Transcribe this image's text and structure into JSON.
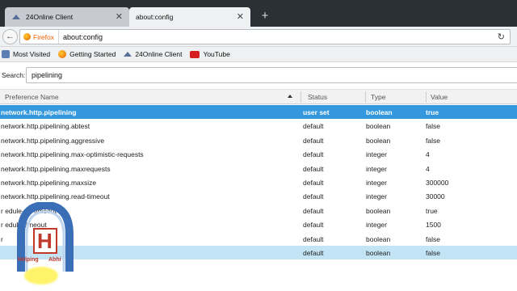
{
  "tabs": [
    {
      "title": "24Online Client",
      "close": "✕"
    },
    {
      "title": "about:config",
      "close": "✕"
    }
  ],
  "new_tab": "+",
  "nav": {
    "back": "←",
    "identity": "Firefox",
    "url": "about:config",
    "reload": "↻"
  },
  "bookmarks": [
    {
      "label": "Most Visited"
    },
    {
      "label": "Getting Started"
    },
    {
      "label": "24Online Client"
    },
    {
      "label": "YouTube"
    }
  ],
  "search": {
    "label": "Search:",
    "value": "pipelining"
  },
  "columns": [
    "Preference Name",
    "Status",
    "Type",
    "Value"
  ],
  "rows": [
    {
      "name": "network.http.pipelining",
      "status": "user set",
      "type": "boolean",
      "value": "true"
    },
    {
      "name": "network.http.pipelining.abtest",
      "status": "default",
      "type": "boolean",
      "value": "false"
    },
    {
      "name": "network.http.pipelining.aggressive",
      "status": "default",
      "type": "boolean",
      "value": "false"
    },
    {
      "name": "network.http.pipelining.max-optimistic-requests",
      "status": "default",
      "type": "integer",
      "value": "4"
    },
    {
      "name": "network.http.pipelining.maxrequests",
      "status": "default",
      "type": "integer",
      "value": "4"
    },
    {
      "name": "network.http.pipelining.maxsize",
      "status": "default",
      "type": "integer",
      "value": "300000"
    },
    {
      "name": "network.http.pipelining.read-timeout",
      "status": "default",
      "type": "integer",
      "value": "30000"
    },
    {
      "name": "r                  edule-on-timeout",
      "status": "default",
      "type": "boolean",
      "value": "true"
    },
    {
      "name": "r                  edule-timeout",
      "status": "default",
      "type": "integer",
      "value": "1500"
    },
    {
      "name": "r",
      "status": "default",
      "type": "boolean",
      "value": "false"
    },
    {
      "name": "",
      "status": "default",
      "type": "boolean",
      "value": "false"
    }
  ],
  "logo": {
    "letter": "H",
    "left_word": "Helping",
    "right_word": "Abhi"
  },
  "colors": {
    "selected_row": "#3398dd",
    "highlight_row": "#c3e4f5",
    "tabstrip": "#2b2f36"
  }
}
